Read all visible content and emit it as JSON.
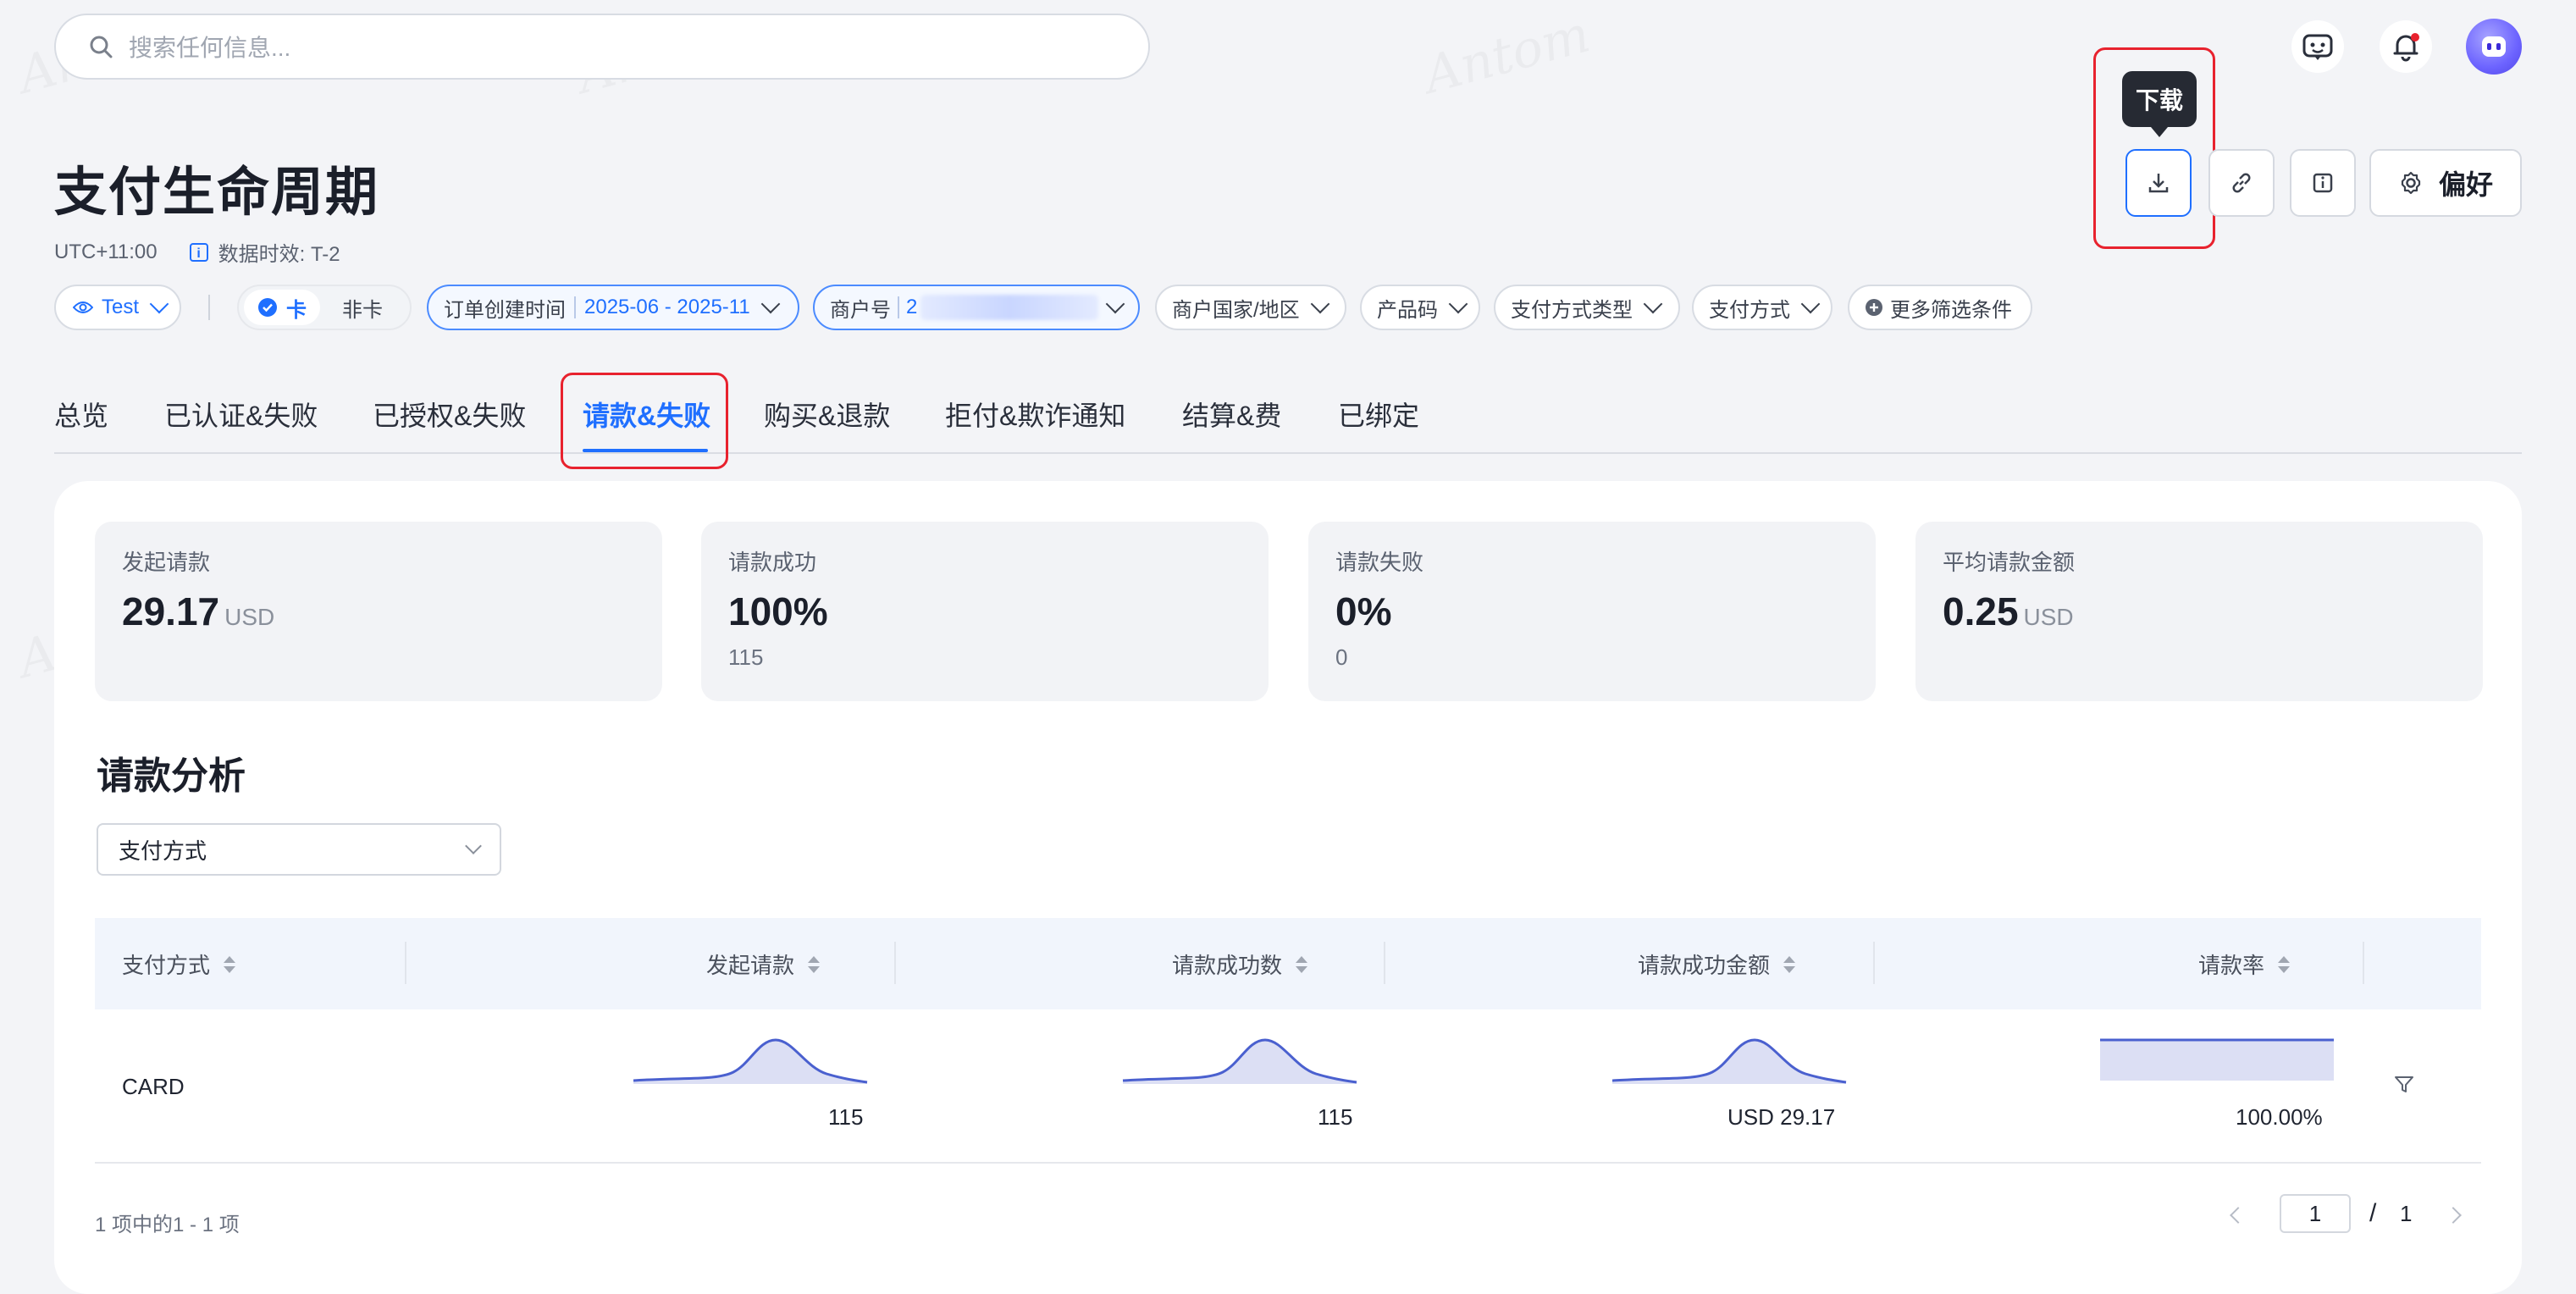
{
  "search": {
    "placeholder": "搜索任何信息..."
  },
  "page": {
    "title": "支付生命周期",
    "timezone": "UTC+11:00",
    "data_freshness": "数据时效: T-2"
  },
  "actions": {
    "tooltip": "下载",
    "preferences_label": "偏好"
  },
  "filters": {
    "env": "Test",
    "card_tab": "卡",
    "non_card_tab": "非卡",
    "order_time_label": "订单创建时间",
    "order_time_value": "2025-06 - 2025-11",
    "merchant_label": "商户号",
    "merchant_value": "2",
    "merchant_country": "商户国家/地区",
    "product_code": "产品码",
    "payment_method_type": "支付方式类型",
    "payment_method": "支付方式",
    "more_filters": "更多筛选条件"
  },
  "tabs": [
    {
      "label": "总览"
    },
    {
      "label": "已认证&失败"
    },
    {
      "label": "已授权&失败"
    },
    {
      "label": "请款&失败"
    },
    {
      "label": "购买&退款"
    },
    {
      "label": "拒付&欺诈通知"
    },
    {
      "label": "结算&费"
    },
    {
      "label": "已绑定"
    }
  ],
  "kpis": [
    {
      "label": "发起请款",
      "value": "29.17",
      "unit": "USD",
      "sub": ""
    },
    {
      "label": "请款成功",
      "value": "100%",
      "unit": "",
      "sub": "115"
    },
    {
      "label": "请款失败",
      "value": "0%",
      "unit": "",
      "sub": "0"
    },
    {
      "label": "平均请款金额",
      "value": "0.25",
      "unit": "USD",
      "sub": ""
    }
  ],
  "analysis": {
    "title": "请款分析",
    "dimension_select": "支付方式"
  },
  "table": {
    "columns": [
      "支付方式",
      "发起请款",
      "请款成功数",
      "请款成功金额",
      "请款率"
    ],
    "rows": [
      {
        "method": "CARD",
        "initiated": "115",
        "success_count": "115",
        "success_amount": "USD 29.17",
        "rate": "100.00%"
      }
    ]
  },
  "pagination": {
    "summary": "1 项中的1 - 1 项",
    "current": "1",
    "separator": "/",
    "total": "1"
  },
  "colors": {
    "accent": "#1f6fff",
    "highlight": "#e8222e",
    "spark": "#4a60cf"
  },
  "watermark": "Antom"
}
